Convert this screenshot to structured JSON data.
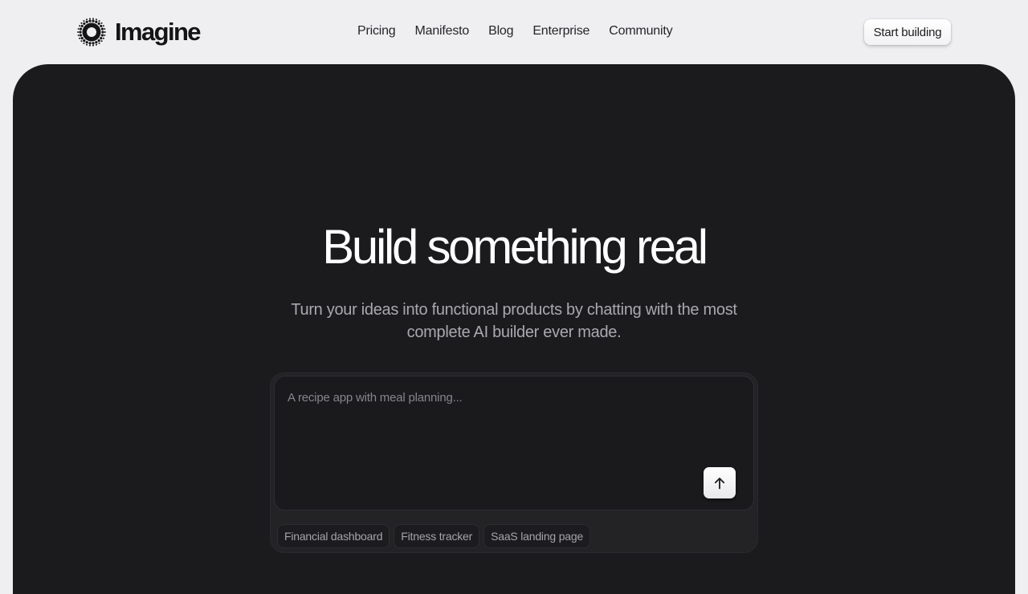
{
  "header": {
    "brand_name": "Imagine",
    "logo_icon": "halftone-sun-logo",
    "nav": [
      {
        "label": "Pricing"
      },
      {
        "label": "Manifesto"
      },
      {
        "label": "Blog"
      },
      {
        "label": "Enterprise"
      },
      {
        "label": "Community"
      }
    ],
    "cta_label": "Start building"
  },
  "hero": {
    "title": "Build something real",
    "subtitle": "Turn your ideas into functional products by chatting with the most complete AI builder ever made.",
    "prompt": {
      "value": "",
      "placeholder": "A recipe app with meal planning...",
      "send_icon": "arrow-up-icon"
    },
    "suggestions": [
      {
        "label": "Financial dashboard"
      },
      {
        "label": "Fitness tracker"
      },
      {
        "label": "SaaS landing page"
      }
    ]
  },
  "colors": {
    "page_background": "#efeff1",
    "hero_background": "#1b1b1e",
    "title_text": "#ffffff",
    "subtitle_text": "#a9a9ae"
  }
}
